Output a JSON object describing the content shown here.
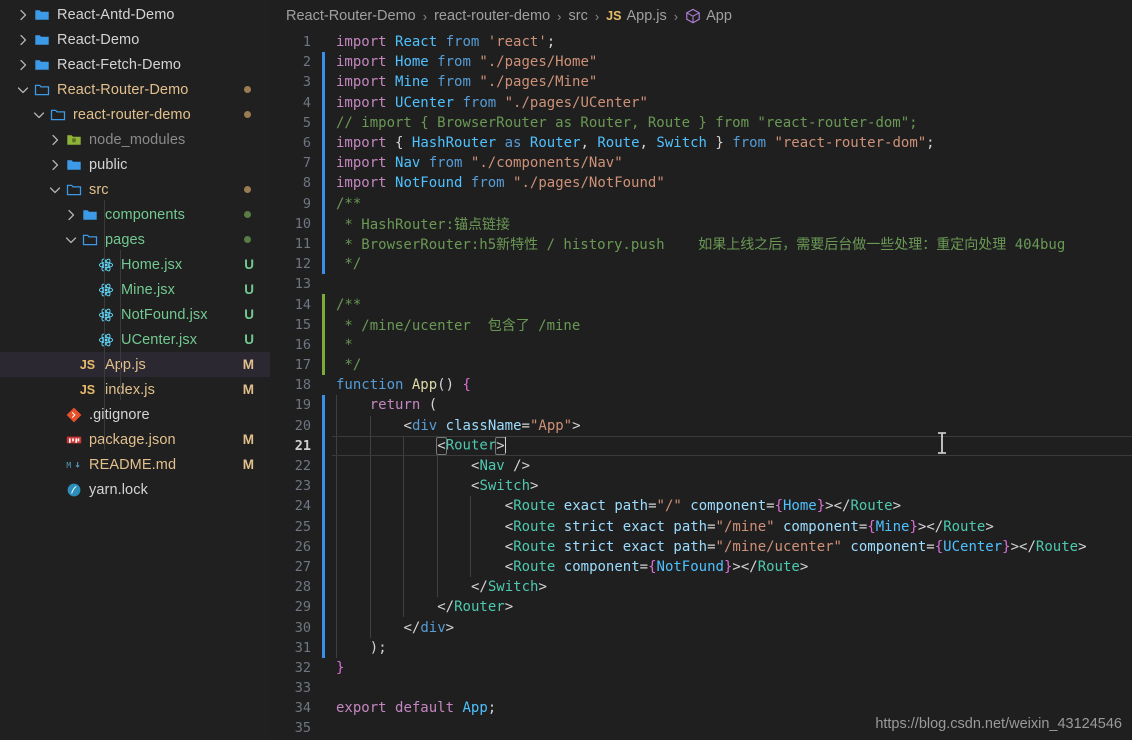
{
  "window": {
    "theme": "dark-plus",
    "background": "#1f1f1f",
    "sidebar_background": "#202020",
    "accent": "#3b8eea"
  },
  "sidebar": {
    "name": "explorer-file-tree",
    "items": [
      {
        "label": "React-Antd-Demo",
        "type": "folder",
        "icon": "folder-icon",
        "indent": 0,
        "twisty": "chevron-right",
        "status": "",
        "dot": "",
        "labelColor": "#d4d4d4",
        "iconColor": "#3c9ae8",
        "active": false
      },
      {
        "label": "React-Demo",
        "type": "folder",
        "icon": "folder-icon",
        "indent": 0,
        "twisty": "chevron-right",
        "status": "",
        "dot": "",
        "labelColor": "#d4d4d4",
        "iconColor": "#3c9ae8",
        "active": false
      },
      {
        "label": "React-Fetch-Demo",
        "type": "folder",
        "icon": "folder-icon",
        "indent": 0,
        "twisty": "chevron-right",
        "status": "",
        "dot": "",
        "labelColor": "#d4d4d4",
        "iconColor": "#3c9ae8",
        "active": false
      },
      {
        "label": "React-Router-Demo",
        "type": "folder",
        "icon": "folder-open-icon",
        "indent": 0,
        "twisty": "chevron-down",
        "status": "",
        "dot": "#9a7b52",
        "labelColor": "#e2c08d",
        "iconColor": "#3c9ae8",
        "active": false
      },
      {
        "label": "react-router-demo",
        "type": "folder",
        "icon": "folder-open-icon",
        "indent": 1,
        "twisty": "chevron-down",
        "status": "",
        "dot": "#9a7b52",
        "labelColor": "#e2c08d",
        "iconColor": "#3c9ae8",
        "active": false
      },
      {
        "label": "node_modules",
        "type": "folder",
        "icon": "folder-node-icon",
        "indent": 2,
        "twisty": "chevron-right",
        "status": "",
        "dot": "",
        "labelColor": "#8a8a8a",
        "iconColor": "#8fb339",
        "active": false
      },
      {
        "label": "public",
        "type": "folder",
        "icon": "folder-icon",
        "indent": 2,
        "twisty": "chevron-right",
        "status": "",
        "dot": "",
        "labelColor": "#d4d4d4",
        "iconColor": "#3c9ae8",
        "active": false
      },
      {
        "label": "src",
        "type": "folder",
        "icon": "folder-open-icon",
        "indent": 2,
        "twisty": "chevron-down",
        "status": "",
        "dot": "#9a7b52",
        "labelColor": "#e2c08d",
        "iconColor": "#3c9ae8",
        "active": false
      },
      {
        "label": "components",
        "type": "folder",
        "icon": "folder-icon",
        "indent": 3,
        "twisty": "chevron-right",
        "status": "",
        "dot": "#587c43",
        "labelColor": "#73c991",
        "iconColor": "#3c9ae8",
        "active": false
      },
      {
        "label": "pages",
        "type": "folder",
        "icon": "folder-open-icon",
        "indent": 3,
        "twisty": "chevron-down",
        "status": "",
        "dot": "#587c43",
        "labelColor": "#73c991",
        "iconColor": "#3c9ae8",
        "active": false
      },
      {
        "label": "Home.jsx",
        "type": "file",
        "icon": "react-icon",
        "indent": 4,
        "twisty": "",
        "status": "U",
        "dot": "",
        "labelColor": "#73c991",
        "iconColor": "#61dafb",
        "statusColor": "#73c991",
        "active": false
      },
      {
        "label": "Mine.jsx",
        "type": "file",
        "icon": "react-icon",
        "indent": 4,
        "twisty": "",
        "status": "U",
        "dot": "",
        "labelColor": "#73c991",
        "iconColor": "#61dafb",
        "statusColor": "#73c991",
        "active": false
      },
      {
        "label": "NotFound.jsx",
        "type": "file",
        "icon": "react-icon",
        "indent": 4,
        "twisty": "",
        "status": "U",
        "dot": "",
        "labelColor": "#73c991",
        "iconColor": "#61dafb",
        "statusColor": "#73c991",
        "active": false
      },
      {
        "label": "UCenter.jsx",
        "type": "file",
        "icon": "react-icon",
        "indent": 4,
        "twisty": "",
        "status": "U",
        "dot": "",
        "labelColor": "#73c991",
        "iconColor": "#61dafb",
        "statusColor": "#73c991",
        "active": false
      },
      {
        "label": "App.js",
        "type": "file",
        "icon": "js-icon",
        "indent": 3,
        "twisty": "",
        "status": "M",
        "dot": "",
        "labelColor": "#e2c08d",
        "iconColor": "#e8bb6b",
        "statusColor": "#e2c08d",
        "active": true
      },
      {
        "label": "index.js",
        "type": "file",
        "icon": "js-icon",
        "indent": 3,
        "twisty": "",
        "status": "M",
        "dot": "",
        "labelColor": "#e2c08d",
        "iconColor": "#e8bb6b",
        "statusColor": "#e2c08d",
        "active": false
      },
      {
        "label": ".gitignore",
        "type": "file",
        "icon": "git-icon",
        "indent": 2,
        "twisty": "",
        "status": "",
        "dot": "",
        "labelColor": "#d4d4d4",
        "iconColor": "#e8502a",
        "active": false
      },
      {
        "label": "package.json",
        "type": "file",
        "icon": "npm-icon",
        "indent": 2,
        "twisty": "",
        "status": "M",
        "dot": "",
        "labelColor": "#e2c08d",
        "iconColor": "#cb3837",
        "statusColor": "#e2c08d",
        "active": false
      },
      {
        "label": "README.md",
        "type": "file",
        "icon": "markdown-icon",
        "indent": 2,
        "twisty": "",
        "status": "M",
        "dot": "",
        "labelColor": "#e2c08d",
        "iconColor": "#519aba",
        "statusColor": "#e2c08d",
        "active": false
      },
      {
        "label": "yarn.lock",
        "type": "file",
        "icon": "yarn-icon",
        "indent": 2,
        "twisty": "",
        "status": "",
        "dot": "",
        "labelColor": "#d4d4d4",
        "iconColor": "#2c8ebb",
        "active": false
      }
    ]
  },
  "breadcrumb": {
    "name": "editor-breadcrumb",
    "separator": "›",
    "crumbs": [
      {
        "label": "React-Router-Demo",
        "icon": ""
      },
      {
        "label": "react-router-demo",
        "icon": ""
      },
      {
        "label": "src",
        "icon": ""
      },
      {
        "label": "App.js",
        "icon": "js-badge"
      },
      {
        "label": "App",
        "icon": "symbol-cube-icon"
      }
    ]
  },
  "editor": {
    "name": "code-editor",
    "file": "App.js",
    "language": "javascriptreact",
    "cursor_line": 21,
    "first_line": 1,
    "last_line": 35,
    "lines": [
      {
        "n": 1,
        "change": "",
        "text": "import React from 'react';"
      },
      {
        "n": 2,
        "change": "blue",
        "text": "import Home from \"./pages/Home\""
      },
      {
        "n": 3,
        "change": "blue",
        "text": "import Mine from \"./pages/Mine\""
      },
      {
        "n": 4,
        "change": "blue",
        "text": "import UCenter from \"./pages/UCenter\""
      },
      {
        "n": 5,
        "change": "blue",
        "text": "// import { BrowserRouter as Router, Route } from \"react-router-dom\";"
      },
      {
        "n": 6,
        "change": "blue",
        "text": "import { HashRouter as Router, Route, Switch } from \"react-router-dom\";"
      },
      {
        "n": 7,
        "change": "blue",
        "text": "import Nav from \"./components/Nav\""
      },
      {
        "n": 8,
        "change": "blue",
        "text": "import NotFound from \"./pages/NotFound\""
      },
      {
        "n": 9,
        "change": "blue",
        "text": "/**"
      },
      {
        "n": 10,
        "change": "blue",
        "text": " * HashRouter:锚点链接"
      },
      {
        "n": 11,
        "change": "blue",
        "text": " * BrowserRouter:h5新特性 / history.push    如果上线之后，需要后台做一些处理：重定向处理 404bug"
      },
      {
        "n": 12,
        "change": "blue",
        "text": " */"
      },
      {
        "n": 13,
        "change": "",
        "text": ""
      },
      {
        "n": 14,
        "change": "green",
        "text": "/**"
      },
      {
        "n": 15,
        "change": "green",
        "text": " * /mine/ucenter  包含了 /mine"
      },
      {
        "n": 16,
        "change": "green",
        "text": " *"
      },
      {
        "n": 17,
        "change": "green",
        "text": " */"
      },
      {
        "n": 18,
        "change": "",
        "text": "function App() {"
      },
      {
        "n": 19,
        "change": "blue",
        "text": "    return ("
      },
      {
        "n": 20,
        "change": "blue",
        "text": "        <div className=\"App\">"
      },
      {
        "n": 21,
        "change": "blue",
        "text": "            <Router>"
      },
      {
        "n": 22,
        "change": "blue",
        "text": "                <Nav />"
      },
      {
        "n": 23,
        "change": "blue",
        "text": "                <Switch>"
      },
      {
        "n": 24,
        "change": "blue",
        "text": "                    <Route exact path=\"/\" component={Home}></Route>"
      },
      {
        "n": 25,
        "change": "blue",
        "text": "                    <Route strict exact path=\"/mine\" component={Mine}></Route>"
      },
      {
        "n": 26,
        "change": "blue",
        "text": "                    <Route strict exact path=\"/mine/ucenter\" component={UCenter}></Route>"
      },
      {
        "n": 27,
        "change": "blue",
        "text": "                    <Route component={NotFound}></Route>"
      },
      {
        "n": 28,
        "change": "blue",
        "text": "                </Switch>"
      },
      {
        "n": 29,
        "change": "blue",
        "text": "            </Router>"
      },
      {
        "n": 30,
        "change": "blue",
        "text": "        </div>"
      },
      {
        "n": 31,
        "change": "blue",
        "text": "    );"
      },
      {
        "n": 32,
        "change": "",
        "text": "}"
      },
      {
        "n": 33,
        "change": "",
        "text": ""
      },
      {
        "n": 34,
        "change": "",
        "text": "export default App;"
      },
      {
        "n": 35,
        "change": "",
        "text": ""
      }
    ]
  },
  "watermark": {
    "name": "blog-watermark",
    "text": "https://blog.csdn.net/weixin_43124546"
  }
}
